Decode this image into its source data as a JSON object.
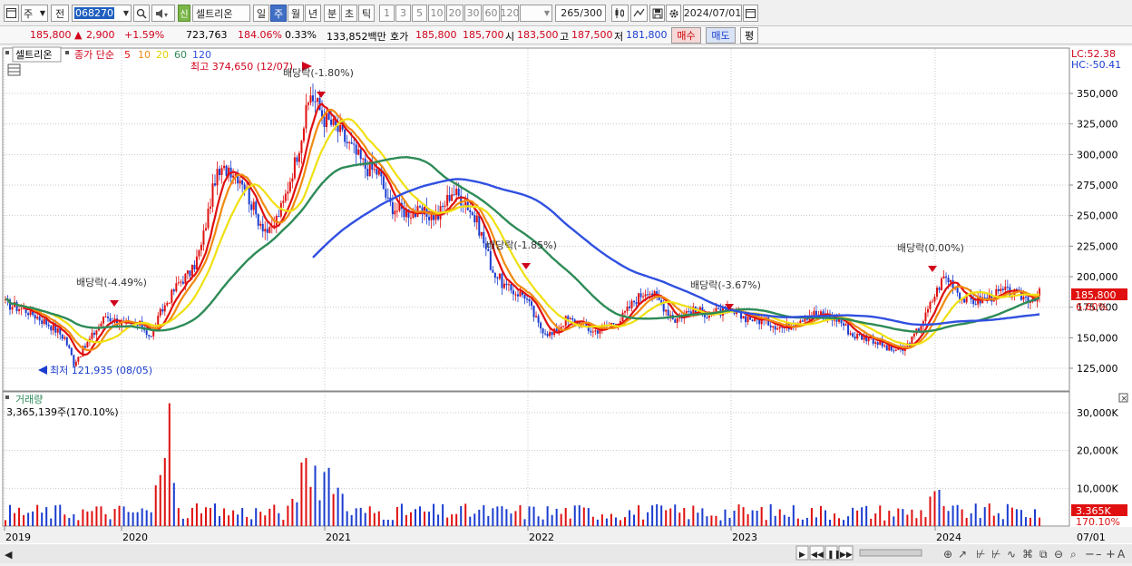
{
  "toolbar": {
    "market_label": "주",
    "prev_label": "전",
    "stock_code": "068270",
    "name_prefix": "신",
    "stock_name": "셀트리온",
    "period_day": "일",
    "period_week": "주",
    "period_month": "월",
    "period_year": "년",
    "period_minute": "분",
    "period_second": "초",
    "period_tick": "틱",
    "intervals": [
      "1",
      "3",
      "5",
      "10",
      "20",
      "30",
      "60",
      "120"
    ],
    "count_value": "265",
    "count_total": "/300",
    "date_value": "2024/07/01"
  },
  "quote": {
    "price": "185,800",
    "change_arrow": "▲",
    "change": "2,900",
    "change_pct": "+1.59%",
    "volume": "723,763",
    "volume_ratio": "184.06%",
    "turnover": "0.33%",
    "amount": "133,852백만",
    "hoga_label": "호가",
    "ask": "185,800",
    "bid": "185,700",
    "open_label": "시",
    "open": "183,500",
    "high_label": "고",
    "high": "187,500",
    "low_label": "저",
    "low": "181,800",
    "buy_label": "매수",
    "sell_label": "매도",
    "eval_label": "평"
  },
  "chart": {
    "legend_name": "셀트리온",
    "legend_ma_prefix": "종가 단순",
    "ma_periods": [
      "5",
      "10",
      "20",
      "60",
      "120"
    ],
    "ma_colors": [
      "#e01010",
      "#f08a10",
      "#f0e010",
      "#2e8b57",
      "#3050e0"
    ],
    "lc_label": "LC:52.38",
    "hc_label": "HC:-50.41",
    "high_annot": "최고 374,650 (12/07)",
    "low_annot": "최저 121,935 (08/05)",
    "dividends": [
      "배당락(-4.49%)",
      "배당락(-1.80%)",
      "배당락(-1.85%)",
      "배당락(-3.67%)",
      "배당락(0.00%)"
    ],
    "price_ticks": [
      "350,000",
      "325,000",
      "300,000",
      "275,000",
      "250,000",
      "225,000",
      "200,000",
      "175,000",
      "150,000",
      "125,000"
    ],
    "current_price_tag": "185,800",
    "current_pct_tag": "6.60%",
    "volume_title": "거래량",
    "volume_value": "3,365,139주(170.10%)",
    "volume_ticks": [
      "30,000K",
      "20,000K",
      "10,000K"
    ],
    "volume_tag": "3.365K",
    "volume_pct_tag": "170.10%",
    "x_labels": [
      "2019",
      "2020",
      "2021",
      "2022",
      "2023",
      "2024",
      "07/01"
    ]
  },
  "chart_data": {
    "type": "candlestick",
    "title": "셀트리온",
    "frequency": "weekly",
    "ylim": [
      110000,
      385000
    ],
    "series": [
      {
        "name": "종가",
        "x": [
          "2019-01",
          "2019-07",
          "2019-08",
          "2020-01",
          "2020-03",
          "2020-07",
          "2020-10",
          "2020-12",
          "2021-03",
          "2021-06",
          "2021-09",
          "2021-12",
          "2022-03",
          "2022-06",
          "2022-09",
          "2022-12",
          "2023-03",
          "2023-06",
          "2023-09",
          "2023-11",
          "2024-01",
          "2024-03",
          "2024-07"
        ],
        "values": [
          180000,
          150000,
          128000,
          165000,
          160000,
          290000,
          235000,
          350000,
          290000,
          255000,
          270000,
          195000,
          175000,
          150000,
          180000,
          165000,
          160000,
          165000,
          155000,
          138000,
          200000,
          180000,
          185800
        ]
      }
    ],
    "annotations": [
      "최고 374,650 (12/07)",
      "최저 121,935 (08/05)"
    ],
    "volume_ylim": [
      0,
      35000000
    ]
  }
}
